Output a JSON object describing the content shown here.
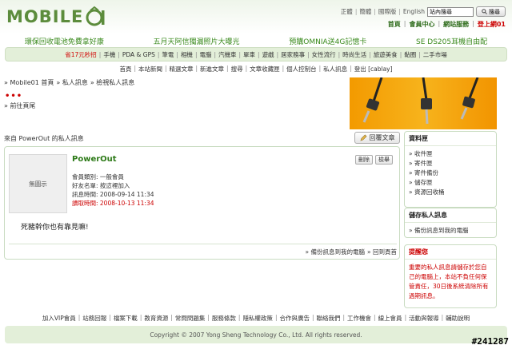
{
  "header": {
    "logo_text": "MOBILE",
    "links": [
      "正體",
      "簡體",
      "國際版",
      "English"
    ],
    "search_value": "站內搜尋",
    "search_button": "搜尋",
    "user_links": [
      "首頁",
      "會員中心",
      "網站服務"
    ],
    "logout": "登上網01"
  },
  "promo": [
    "環保回收電池免費拿好康",
    "五月天阿信獨漏照片大曝光",
    "預購OMNIA送4G記憶卡",
    "SE DS205耳機自由配"
  ],
  "categories": [
    "省17元秒招",
    "手機",
    "PDA & GPS",
    "筆電",
    "相機",
    "電腦",
    "汽機車",
    "單車",
    "遊戲",
    "居家務事",
    "女性流行",
    "時尚生活",
    "旅遊美食",
    "黏圈",
    "二手市場"
  ],
  "subnav": [
    "首頁",
    "本站新聞",
    "精選文章",
    "新進文章",
    "搜尋",
    "文章收藏匣",
    "個人控制台",
    "私人訊息",
    "登出 [cablay]"
  ],
  "breadcrumb": [
    "» Mobile01 首頁",
    "» 私人訊息",
    "» 檢視私人訊息"
  ],
  "prev_page": "» 前往頁尾",
  "message": {
    "from_line": "來自 PowerOut 的私人訊息",
    "reply_button": "回覆文章",
    "avatar_label": "無圖示",
    "sender": "PowerOut",
    "delete": "刪除",
    "report": "檢舉",
    "member_type": "會員類別: 一般會員",
    "friend_add": "好友名單: 按這裡加入",
    "sent_time": "訊息時間: 2008-09-14 11:34",
    "read_time": "讀取時間: 2008-10-13 11:34",
    "body": "死豬幹你也有靠見嘛!",
    "footer_links": [
      "» 備份訊息到我的電腦",
      "» 回到頁首"
    ]
  },
  "sidebar": {
    "folders_title": "資料匣",
    "folders": [
      "» 收件匣",
      "» 寄件匣",
      "» 寄件備份",
      "» 儲存匣",
      "» 資源回收桶"
    ],
    "save_title": "儲存私人訊息",
    "save_items": [
      "» 備份訊息到我的電腦"
    ],
    "notice_title": "提醒您",
    "notice_text": "重要的私人訊息請儲存於您自己的電腦上，本站不負任何保管責任，30日後系統清除所有過期訊息。"
  },
  "footer": {
    "links": [
      "加入VIP會員",
      "站務回報",
      "檔案下載",
      "教育資源",
      "常問問題集",
      "服務條款",
      "隱私權政策",
      "合作與廣告",
      "聯絡我們",
      "工作機會",
      "線上會員",
      "活動與報導",
      "輔助說明"
    ],
    "copyright": "Copyright © 2007 Yong Sheng Technology Co., Ltd. All rights reserved.",
    "watermark": "#241287"
  },
  "colors": {
    "brand_green": "#5c8c3c",
    "link_green": "#3a8a1d",
    "accent_red": "#c00000",
    "banner_orange": "#f5a20c"
  }
}
